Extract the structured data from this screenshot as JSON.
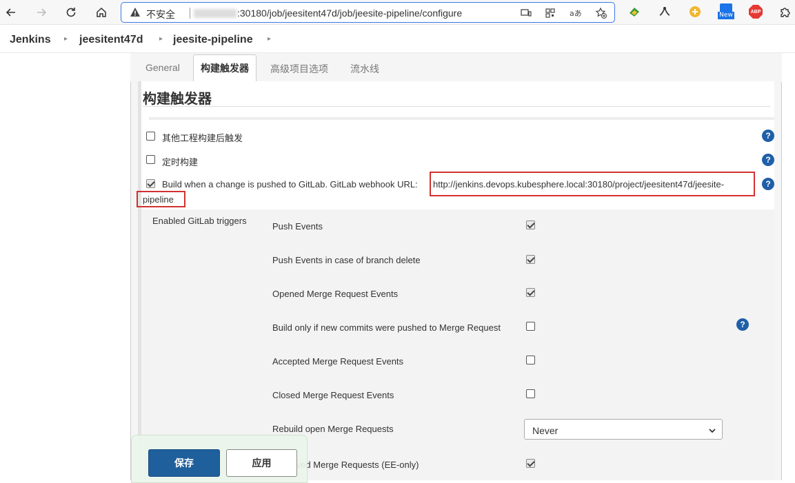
{
  "browser": {
    "insecure_label": "不安全",
    "url": ":30180/job/jeesitent47d/job/jeesite-pipeline/configure",
    "ext_new_badge": "New",
    "ext_abp_label": "ABP"
  },
  "breadcrumb": {
    "items": [
      "Jenkins",
      "jeesitent47d",
      "jeesite-pipeline"
    ]
  },
  "tabs": {
    "general": "General",
    "triggers": "构建触发器",
    "advanced": "高级项目选项",
    "pipeline": "流水线"
  },
  "section": {
    "title": "构建触发器"
  },
  "options": {
    "other_projects": "其他工程构建后触发",
    "scheduled": "定时构建",
    "gitlab_push_label": "Build when a change is pushed to GitLab. GitLab webhook URL:",
    "gitlab_webhook_url_line1": "http://jenkins.devops.kubesphere.local:30180/project/jeesitent47d/jeesite-",
    "gitlab_webhook_url_line2": "pipeline"
  },
  "gitlab_triggers": {
    "header": "Enabled GitLab triggers",
    "items": [
      {
        "label": "Push Events",
        "checked": true
      },
      {
        "label": "Push Events in case of branch delete",
        "checked": true
      },
      {
        "label": "Opened Merge Request Events",
        "checked": true
      },
      {
        "label": "Build only if new commits were pushed to Merge Request",
        "checked": false
      },
      {
        "label": "Accepted Merge Request Events",
        "checked": false
      },
      {
        "label": "Closed Merge Request Events",
        "checked": false
      },
      {
        "label": "Rebuild open Merge Requests",
        "checked": null
      },
      {
        "label": "Approved Merge Requests (EE-only)",
        "checked": true
      }
    ],
    "rebuild_select_value": "Never"
  },
  "buttons": {
    "save": "保存",
    "apply": "应用"
  },
  "help_glyph": "?",
  "colors": {
    "help_blue": "#1e5fa8",
    "save_blue": "#1f5f9c",
    "highlight_red": "#d32f2f"
  }
}
